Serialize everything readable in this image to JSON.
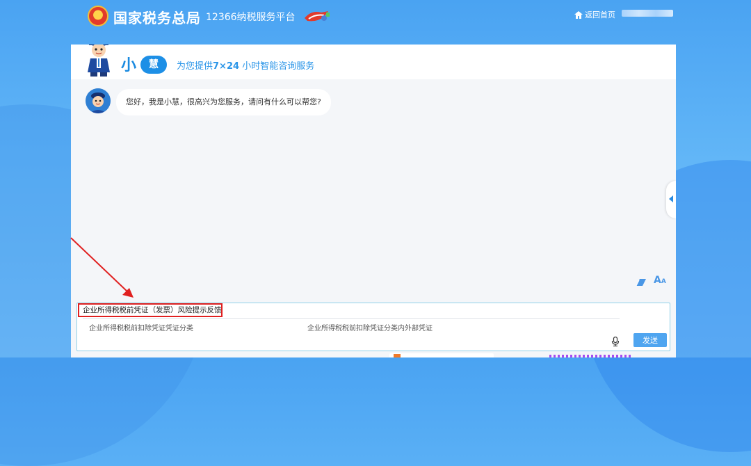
{
  "header": {
    "logo_title": "国家税务总局",
    "platform_name": "12366纳税服务平台",
    "home_link": "返回首页"
  },
  "assistant": {
    "name_char1": "小",
    "name_char2": "慧",
    "slogan_pre": "为您提供",
    "slogan_bold": "7×24",
    "slogan_post": "小时智能咨询服务",
    "greeting": "您好，我是小慧，很高兴为您服务，请问有什么可以帮您?"
  },
  "input": {
    "query": "企业所得税税前凭证（发票）风险提示反馈",
    "suggestions": [
      "企业所得税税前扣除凭证凭证分类",
      "企业所得税税前扣除凭证分类内外部凭证"
    ],
    "send_label": "发送"
  },
  "toolbar": {
    "font_big": "A",
    "font_small": "A"
  },
  "colors": {
    "accent": "#1d8fe6",
    "highlight_box": "#e02020",
    "send_button": "#4fa5f0"
  },
  "icons": [
    "home-icon",
    "emblem-icon",
    "mascot-icon",
    "eraser-icon",
    "font-size-icon",
    "microphone-icon",
    "collapse-arrow-icon"
  ]
}
